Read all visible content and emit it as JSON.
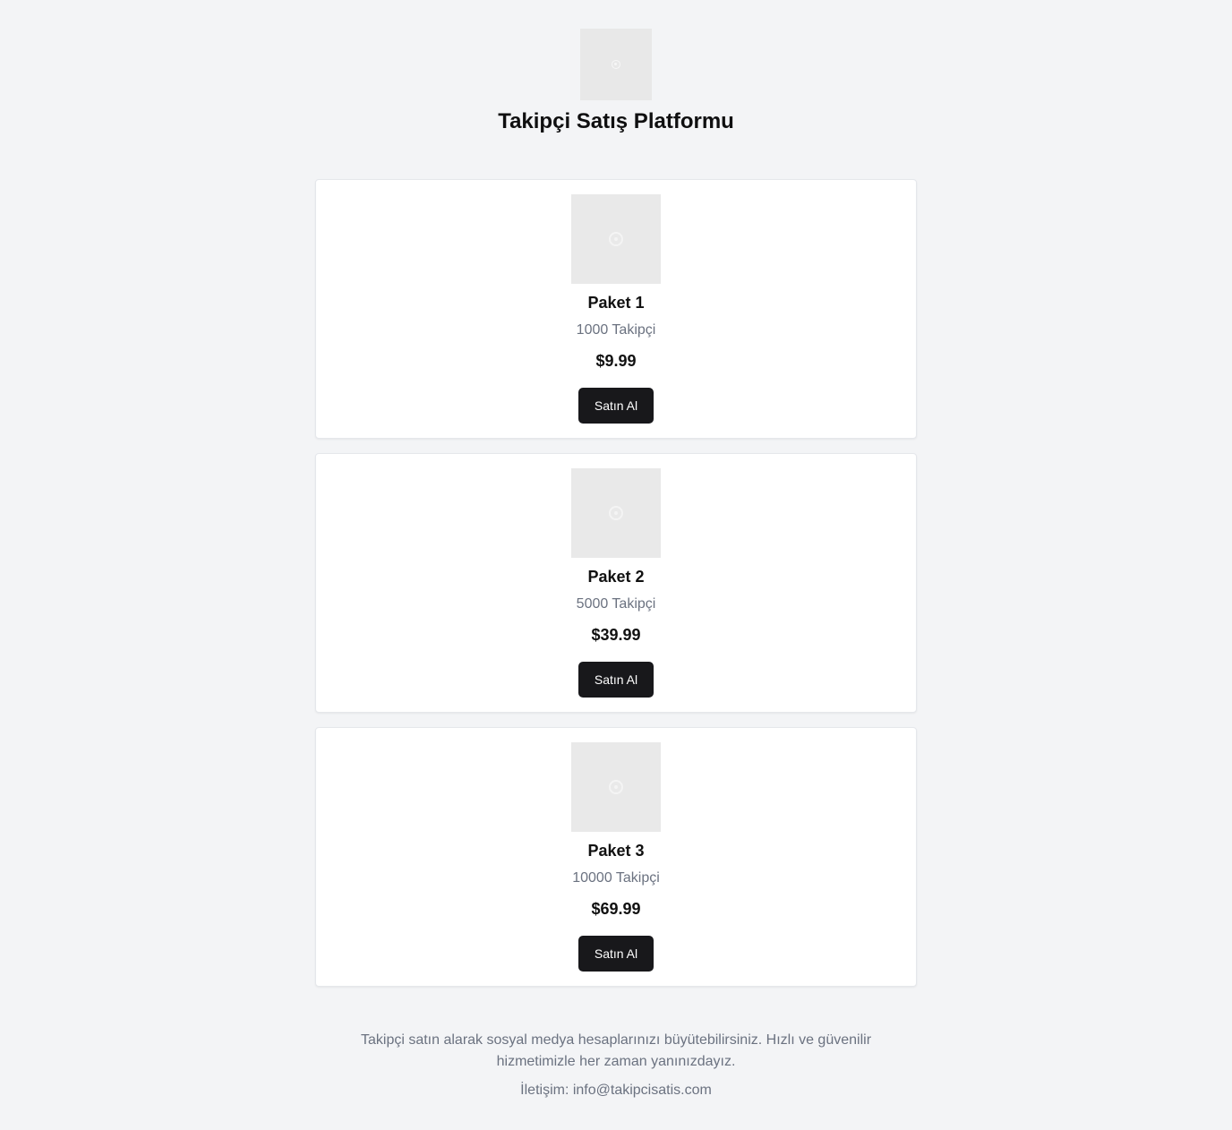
{
  "header": {
    "logo_icon": "image-placeholder-icon",
    "title": "Takipçi Satış Platformu"
  },
  "packages": [
    {
      "image_icon": "image-placeholder-icon",
      "name": "Paket 1",
      "followers": "1000 Takipçi",
      "price": "$9.99",
      "button_label": "Satın Al"
    },
    {
      "image_icon": "image-placeholder-icon",
      "name": "Paket 2",
      "followers": "5000 Takipçi",
      "price": "$39.99",
      "button_label": "Satın Al"
    },
    {
      "image_icon": "image-placeholder-icon",
      "name": "Paket 3",
      "followers": "10000 Takipçi",
      "price": "$69.99",
      "button_label": "Satın Al"
    }
  ],
  "footer": {
    "description": "Takipçi satın alarak sosyal medya hesaplarınızı büyütebilirsiniz. Hızlı ve güvenilir hizmetimizle her zaman yanınızdayız.",
    "contact": "İletişim: info@takipcisatis.com"
  },
  "colors": {
    "background": "#f3f4f6",
    "card": "#ffffff",
    "button": "#18181b",
    "muted_text": "#6b7280"
  }
}
